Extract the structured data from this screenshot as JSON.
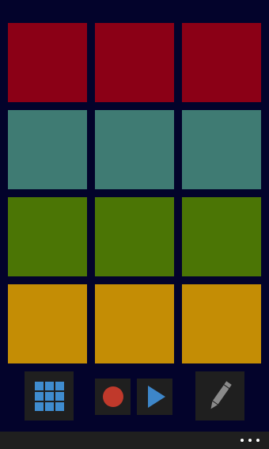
{
  "app": {
    "background": "#03032b",
    "toolbar_background": "#1f1f1f"
  },
  "pads": {
    "rows": [
      {
        "color": "#8b0016",
        "count": 3
      },
      {
        "color": "#3f7b73",
        "count": 3
      },
      {
        "color": "#4b7505",
        "count": 3
      },
      {
        "color": "#c48d05",
        "count": 3
      }
    ]
  },
  "toolbar": {
    "buttons": [
      {
        "name": "pad-grid-button",
        "icon": "grid-icon",
        "icon_color": "#3f8ccf"
      },
      {
        "name": "record-button",
        "icon": "record-icon",
        "icon_color": "#c0392b"
      },
      {
        "name": "play-button",
        "icon": "play-icon",
        "icon_color": "#3d86c9"
      },
      {
        "name": "edit-button",
        "icon": "pencil-icon",
        "icon_color": "#8a8a8a"
      }
    ]
  },
  "app_bar": {
    "more_icon": "ellipsis-icon"
  }
}
